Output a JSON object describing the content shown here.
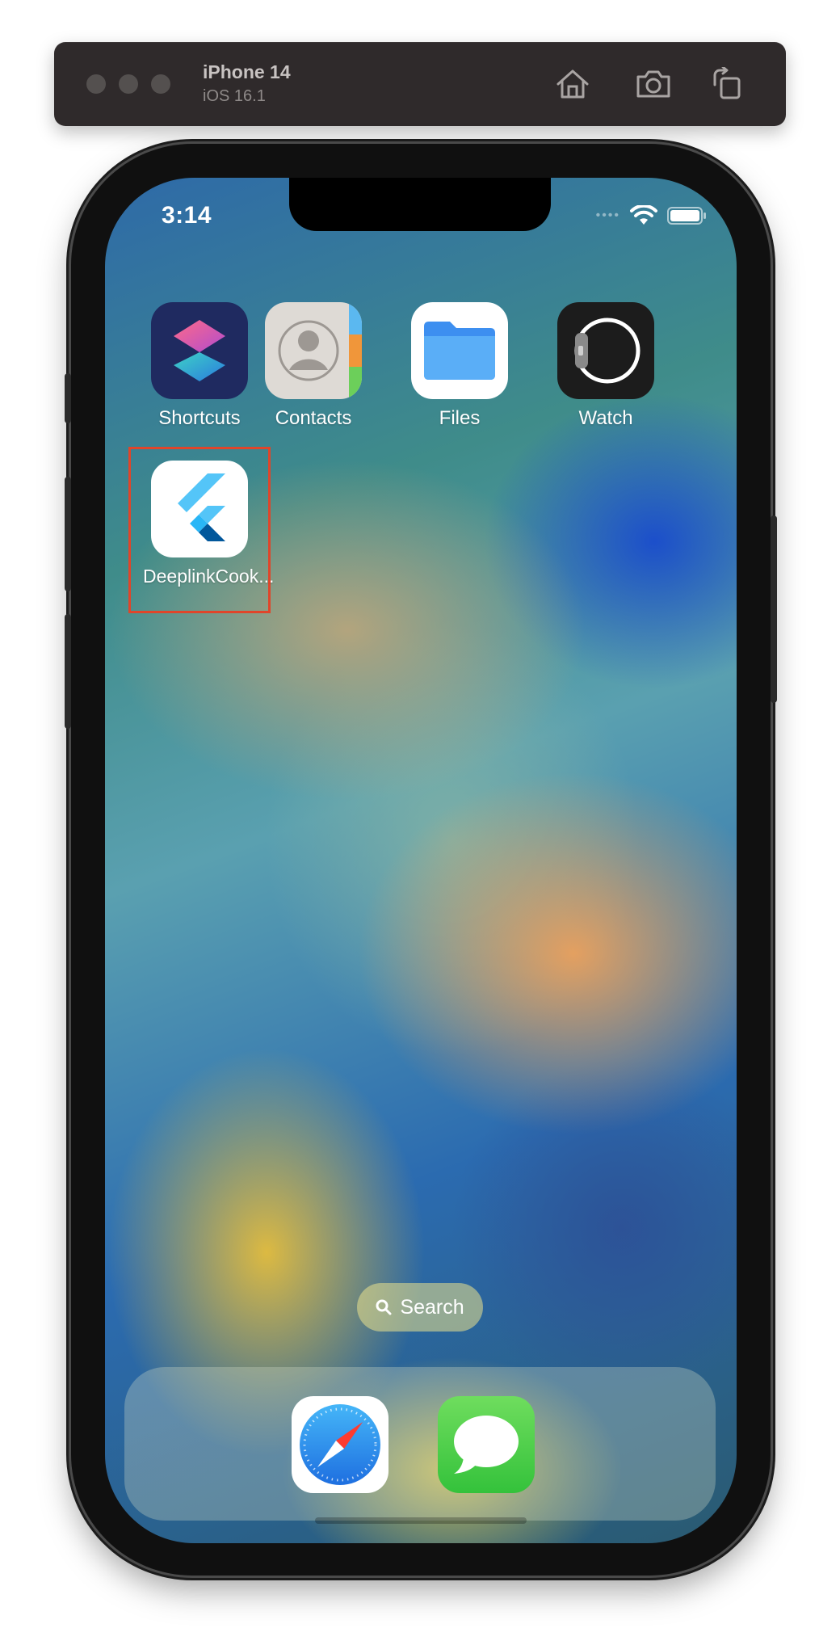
{
  "simulator": {
    "device_name": "iPhone 14",
    "os_version": "iOS 16.1",
    "icons": [
      "home-icon",
      "screenshot-icon",
      "rotate-icon"
    ]
  },
  "status_bar": {
    "time": "3:14",
    "icons": [
      "cellular-signal-icon",
      "wifi-icon",
      "battery-icon"
    ]
  },
  "home_apps": [
    {
      "label": "Shortcuts",
      "icon": "shortcuts-icon"
    },
    {
      "label": "Contacts",
      "icon": "contacts-icon"
    },
    {
      "label": "Files",
      "icon": "files-icon"
    },
    {
      "label": "Watch",
      "icon": "watch-icon"
    },
    {
      "label": "DeeplinkCook...",
      "icon": "flutter-icon"
    }
  ],
  "search": {
    "label": "Search",
    "icon": "search-icon"
  },
  "dock": [
    {
      "name": "Safari",
      "icon": "safari-icon"
    },
    {
      "name": "Messages",
      "icon": "messages-icon"
    }
  ],
  "colors": {
    "highlight_border": "#e0452a",
    "simulator_bar": "#2f2a2b"
  }
}
